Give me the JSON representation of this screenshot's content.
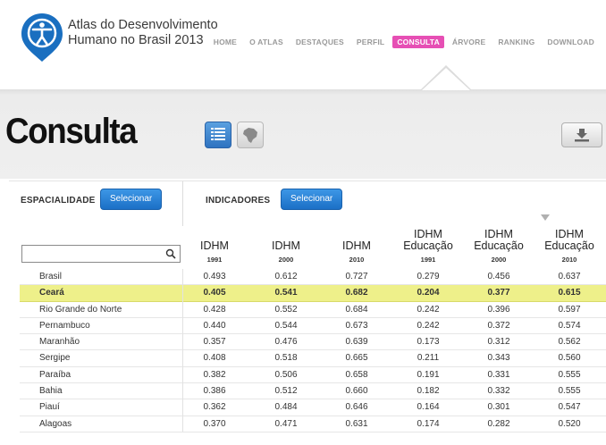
{
  "header": {
    "brand_line1": "Atlas do Desenvolvimento",
    "brand_line2": "Humano no Brasil 2013",
    "nav": [
      {
        "label": "HOME",
        "active": false
      },
      {
        "label": "O ATLAS",
        "active": false
      },
      {
        "label": "DESTAQUES",
        "active": false
      },
      {
        "label": "PERFIL",
        "active": false
      },
      {
        "label": "CONSULTA",
        "active": true
      },
      {
        "label": "ÁRVORE",
        "active": false
      },
      {
        "label": "RANKING",
        "active": false
      },
      {
        "label": "DOWNLOAD",
        "active": false
      }
    ],
    "active_color": "#e64fb4"
  },
  "page": {
    "title": "Consulta",
    "icons": {
      "table_view": "table-icon",
      "map_view": "brazil-map-icon",
      "download": "download-icon"
    }
  },
  "filters": {
    "espacialidade_label": "ESPACIALIDADE",
    "indicadores_label": "INDICADORES",
    "select_label": "Selecionar",
    "search_value": "",
    "search_icon": "search-icon"
  },
  "columns": [
    {
      "name": "IDHM",
      "sub": "",
      "year": "1991"
    },
    {
      "name": "IDHM",
      "sub": "",
      "year": "2000"
    },
    {
      "name": "IDHM",
      "sub": "",
      "year": "2010"
    },
    {
      "name": "IDHM",
      "sub": "Educação",
      "year": "1991"
    },
    {
      "name": "IDHM",
      "sub": "Educação",
      "year": "2000"
    },
    {
      "name": "IDHM",
      "sub": "Educação",
      "year": "2010"
    }
  ],
  "rows": [
    {
      "name": "Brasil",
      "values": [
        "0.493",
        "0.612",
        "0.727",
        "0.279",
        "0.456",
        "0.637"
      ],
      "highlight": false
    },
    {
      "name": "Ceará",
      "values": [
        "0.405",
        "0.541",
        "0.682",
        "0.204",
        "0.377",
        "0.615"
      ],
      "highlight": true
    },
    {
      "name": "Rio Grande do Norte",
      "values": [
        "0.428",
        "0.552",
        "0.684",
        "0.242",
        "0.396",
        "0.597"
      ],
      "highlight": false
    },
    {
      "name": "Pernambuco",
      "values": [
        "0.440",
        "0.544",
        "0.673",
        "0.242",
        "0.372",
        "0.574"
      ],
      "highlight": false
    },
    {
      "name": "Maranhão",
      "values": [
        "0.357",
        "0.476",
        "0.639",
        "0.173",
        "0.312",
        "0.562"
      ],
      "highlight": false
    },
    {
      "name": "Sergipe",
      "values": [
        "0.408",
        "0.518",
        "0.665",
        "0.211",
        "0.343",
        "0.560"
      ],
      "highlight": false
    },
    {
      "name": "Paraíba",
      "values": [
        "0.382",
        "0.506",
        "0.658",
        "0.191",
        "0.331",
        "0.555"
      ],
      "highlight": false
    },
    {
      "name": "Bahia",
      "values": [
        "0.386",
        "0.512",
        "0.660",
        "0.182",
        "0.332",
        "0.555"
      ],
      "highlight": false
    },
    {
      "name": "Piauí",
      "values": [
        "0.362",
        "0.484",
        "0.646",
        "0.164",
        "0.301",
        "0.547"
      ],
      "highlight": false
    },
    {
      "name": "Alagoas",
      "values": [
        "0.370",
        "0.471",
        "0.631",
        "0.174",
        "0.282",
        "0.520"
      ],
      "highlight": false
    }
  ],
  "highlight_color": "#eef08a"
}
